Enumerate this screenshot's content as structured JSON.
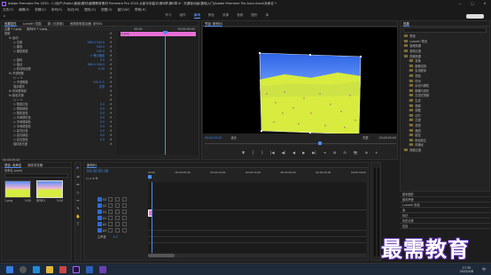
{
  "window": {
    "title": "Adobe Premiere Pro 2020 - C:\\用户\\Public\\桌面\\素材\\最需教育素材 Premiere Pro 2020 从新手到高手\\第8章\\第8章-8 · 关键帧动画\\基础入门\\Adobe Premiere Pro Auto-Save\\未命名 *",
    "min": "—",
    "max": "□",
    "close": "✕"
  },
  "menu": [
    "文件(F)",
    "编辑(E)",
    "剪辑(C)",
    "序列(S)",
    "标记(M)",
    "图形(G)",
    "视图(V)",
    "窗口(W)",
    "帮助(H)"
  ],
  "workspaces": [
    "学习",
    "组件",
    "编辑",
    "颜色",
    "效果",
    "音频",
    "图形",
    "库"
  ],
  "effect_controls": {
    "tabs": [
      "效果控件",
      "Lumetri 范围",
      "源: (无剪辑)",
      "音频剪辑混合器: 序列01"
    ],
    "source": "主要 * 1.png",
    "seq": "序列01 * 1.png",
    "timecode_left": "00:00",
    "timecode_right": "00:00:05:00",
    "clip_label": "1.png",
    "rows": [
      {
        "label": "视频",
        "indent": 0,
        "value": ""
      },
      {
        "label": "fx 运动",
        "indent": 1,
        "value": ""
      },
      {
        "label": "○ 位置",
        "indent": 2,
        "value": "960.0   540.0"
      },
      {
        "label": "○ 缩放",
        "indent": 2,
        "value": "100.0"
      },
      {
        "label": "○ 缩放宽度",
        "indent": 2,
        "value": "100.0"
      },
      {
        "label": "",
        "indent": 2,
        "value": "✔ 等比缩放"
      },
      {
        "label": "○ 旋转",
        "indent": 2,
        "value": "0.0"
      },
      {
        "label": "○ 锚点",
        "indent": 2,
        "value": "960.0   540.0"
      },
      {
        "label": "○ 防闪烁滤镜",
        "indent": 2,
        "value": "0.00"
      },
      {
        "label": "fx 不透明度",
        "indent": 1,
        "value": ""
      },
      {
        "label": "○ ▭ ✎",
        "indent": 2,
        "value": ""
      },
      {
        "label": "○ 不透明度",
        "indent": 2,
        "value": "100.0 %"
      },
      {
        "label": "混合模式",
        "indent": 2,
        "value": "正常"
      },
      {
        "label": "fx 时间重映射",
        "indent": 1,
        "value": ""
      },
      {
        "label": "fx 颜色平衡",
        "indent": 1,
        "value": ""
      },
      {
        "label": "○ ▭ ✎",
        "indent": 2,
        "value": ""
      },
      {
        "label": "○ 阴影红色",
        "indent": 2,
        "value": "0.0"
      },
      {
        "label": "○ 阴影绿色",
        "indent": 2,
        "value": "0.0"
      },
      {
        "label": "○ 阴影蓝色",
        "indent": 2,
        "value": "0.0"
      },
      {
        "label": "○ 中间调红色",
        "indent": 2,
        "value": "0.0"
      },
      {
        "label": "○ 中间调绿色",
        "indent": 2,
        "value": "0.0"
      },
      {
        "label": "○ 中间调蓝色",
        "indent": 2,
        "value": "0.0"
      },
      {
        "label": "○ 高光红色",
        "indent": 2,
        "value": "0.0"
      },
      {
        "label": "○ 高光绿色",
        "indent": 2,
        "value": "0.0"
      },
      {
        "label": "○ 高光蓝色",
        "indent": 2,
        "value": "0.0"
      },
      {
        "label": "保持发光度",
        "indent": 2,
        "value": ""
      }
    ],
    "footer_time": "00:00:05:00"
  },
  "program": {
    "tab": "节目: 序列01",
    "timecode": "00:00:05:00",
    "fit": "适合",
    "quality": "完整",
    "duration": "00:00:05:00",
    "transport": [
      "▼",
      "{",
      "}",
      "|◀",
      "◀|",
      "◀",
      "▶",
      "▶|",
      "⇥",
      "⊞",
      "⊟",
      "📷",
      "⊕",
      "+"
    ]
  },
  "effects": {
    "title": "效果",
    "items": [
      {
        "label": "预设",
        "indent": 0
      },
      {
        "label": "Lumetri 预设",
        "indent": 0
      },
      {
        "label": "音频效果",
        "indent": 0
      },
      {
        "label": "音频过渡",
        "indent": 0
      },
      {
        "label": "视频效果",
        "indent": 0
      },
      {
        "label": "变换",
        "indent": 1
      },
      {
        "label": "图像控制",
        "indent": 1
      },
      {
        "label": "实用程序",
        "indent": 1
      },
      {
        "label": "扭曲",
        "indent": 1
      },
      {
        "label": "时间",
        "indent": 1
      },
      {
        "label": "杂色与颗粒",
        "indent": 1
      },
      {
        "label": "模糊与锐化",
        "indent": 1
      },
      {
        "label": "沉浸式视频",
        "indent": 1
      },
      {
        "label": "生成",
        "indent": 1
      },
      {
        "label": "视频",
        "indent": 1
      },
      {
        "label": "调整",
        "indent": 1
      },
      {
        "label": "过时",
        "indent": 1
      },
      {
        "label": "过渡",
        "indent": 1
      },
      {
        "label": "透视",
        "indent": 1
      },
      {
        "label": "通道",
        "indent": 1
      },
      {
        "label": "键控",
        "indent": 1
      },
      {
        "label": "颜色校正",
        "indent": 1
      },
      {
        "label": "风格化",
        "indent": 1
      },
      {
        "label": "视频过渡",
        "indent": 0
      }
    ],
    "lower": [
      "基本图形",
      "基本声音",
      "Lumetri 颜色",
      "库",
      "标记",
      "历史记录",
      "信息"
    ]
  },
  "project": {
    "tabs": [
      "项目: 未命名",
      "媒体浏览器"
    ],
    "name": "未命名.prproj",
    "items": [
      {
        "label": "1.png",
        "meta": "5:00"
      },
      {
        "label": "序列01",
        "meta": "5:00"
      }
    ]
  },
  "timeline": {
    "tab": "序列01",
    "timecode": "00:00:05:00",
    "ruler": [
      "00:00",
      "00:00:05:00",
      "00:00:10:00",
      "00:00:15:00",
      "00:00:20:00",
      "00:00:25:00",
      "00:00:30:00"
    ],
    "tracks": [
      {
        "name": "V3"
      },
      {
        "name": "V2"
      },
      {
        "name": "V1"
      },
      {
        "name": "A1"
      },
      {
        "name": "A2"
      },
      {
        "name": "A3"
      }
    ],
    "master": "主声道",
    "master_val": "0.0"
  },
  "taskbar": {
    "time": "17:20",
    "date": "2022/4/8",
    "lang": "中"
  },
  "watermark": "最需教育",
  "colors": {
    "accent": "#3f8bf2",
    "clip_pink": "#e86fd6",
    "clip_green": "#7ed957",
    "playhead": "#4b8ff7"
  }
}
